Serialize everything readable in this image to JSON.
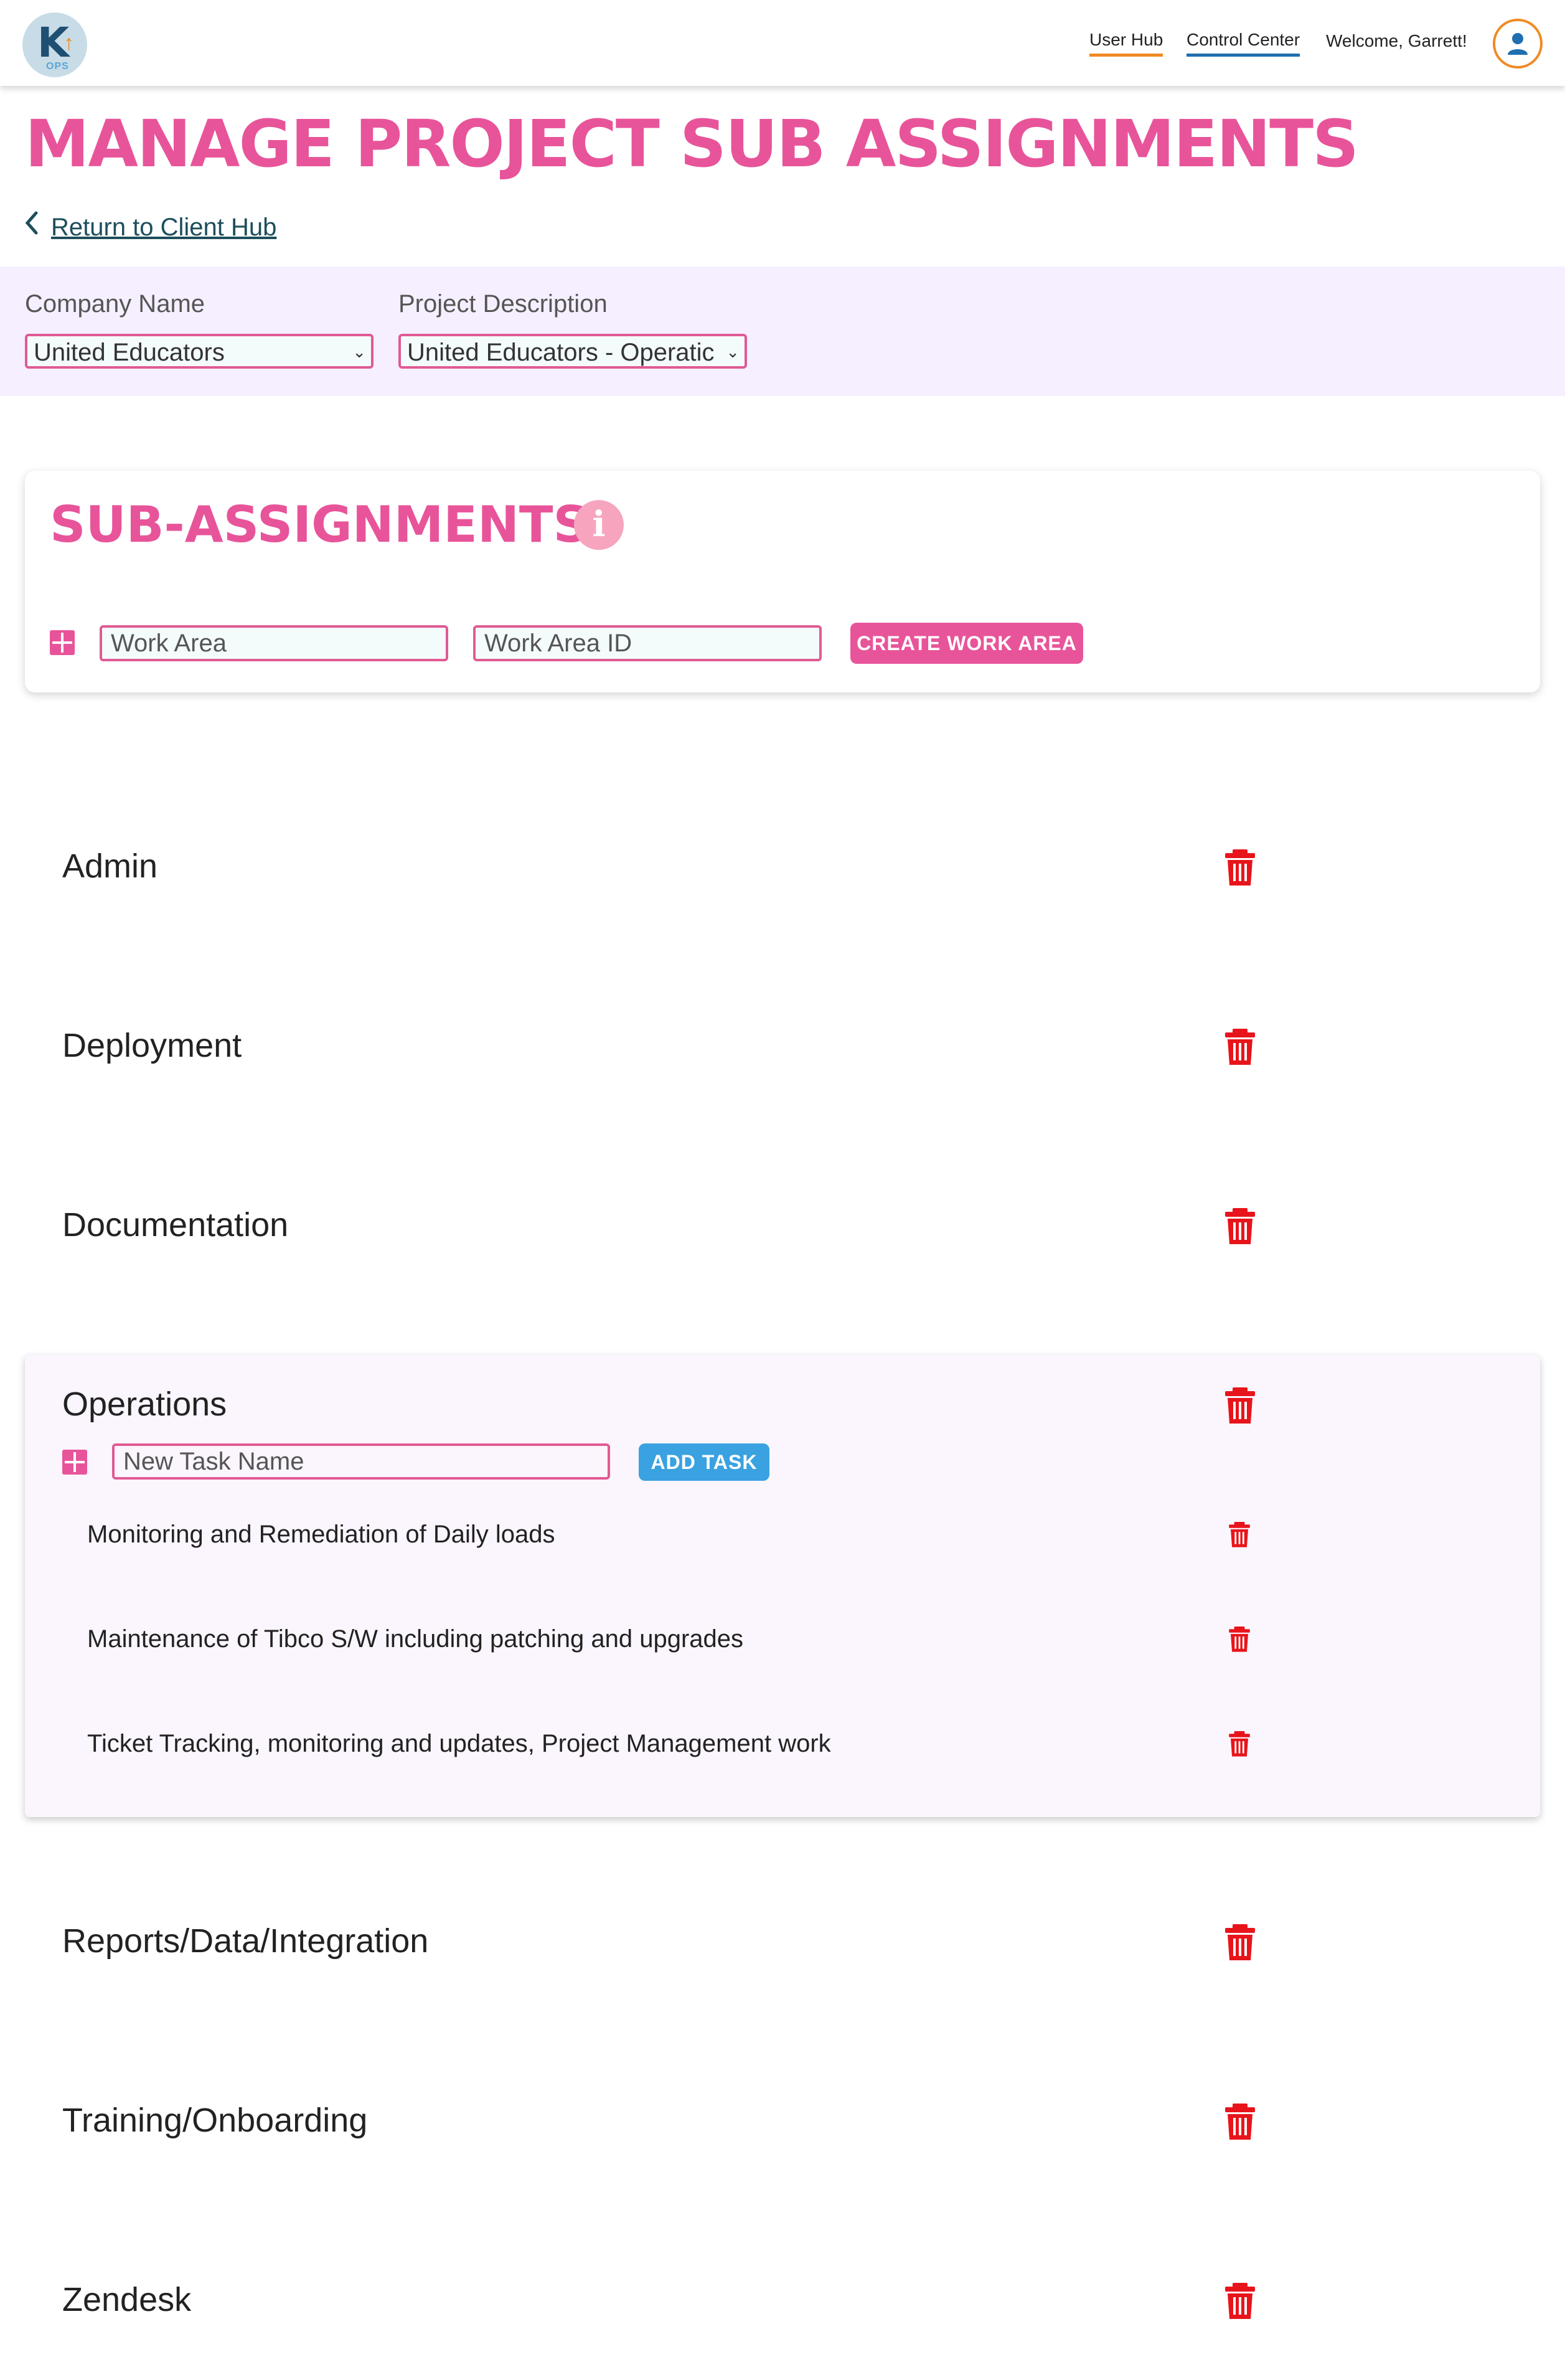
{
  "header": {
    "logo_text": "K",
    "logo_sub": "OPS",
    "nav": [
      {
        "label": "User Hub"
      },
      {
        "label": "Control Center"
      }
    ],
    "welcome": "Welcome, Garrett!",
    "accent_orange": "#f08a24",
    "accent_blue": "#1f6fb0"
  },
  "page": {
    "title": "MANAGE PROJECT SUB ASSIGNMENTS",
    "return_link": "Return to Client Hub",
    "title_color": "#e8549a"
  },
  "filters": {
    "company_label": "Company Name",
    "company_value": "United Educators",
    "project_label": "Project Description",
    "project_value": "United Educators - Operatic"
  },
  "sub_assignments": {
    "title": "SUB-ASSIGNMENTS",
    "work_area_placeholder": "Work Area",
    "work_area_id_placeholder": "Work Area ID",
    "create_button": "CREATE WORK AREA"
  },
  "work_areas": [
    {
      "name": "Admin"
    },
    {
      "name": "Deployment"
    },
    {
      "name": "Documentation"
    },
    {
      "name": "Operations",
      "expanded": true,
      "task_placeholder": "New Task Name",
      "add_task_button": "ADD TASK",
      "tasks": [
        {
          "name": "Monitoring and Remediation of Daily loads"
        },
        {
          "name": "Maintenance of Tibco S/W  including patching and upgrades"
        },
        {
          "name": "Ticket Tracking, monitoring and updates, Project Management work"
        }
      ]
    },
    {
      "name": "Reports/Data/Integration"
    },
    {
      "name": "Training/Onboarding"
    },
    {
      "name": "Zendesk"
    }
  ],
  "colors": {
    "delete_red": "#e8141b",
    "add_task_blue": "#3aa2e0",
    "filter_band": "#f6efff"
  }
}
